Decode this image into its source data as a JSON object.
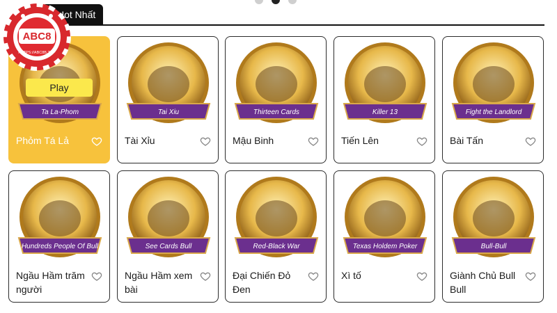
{
  "tab_active_label": "Hot Nhất",
  "logo": {
    "text": "ABC8",
    "url": "HTTPS://ABC8B.TOP"
  },
  "play_label": "Play",
  "cards": [
    {
      "title": "Phỏm Tá Lả",
      "banner": "Ta La-Phom",
      "highlight": true
    },
    {
      "title": "Tài Xỉu",
      "banner": "Tai Xiu"
    },
    {
      "title": "Mậu Binh",
      "banner": "Thirteen Cards"
    },
    {
      "title": "Tiến Lên",
      "banner": "Killer 13"
    },
    {
      "title": "Bài Tấn",
      "banner": "Fight the Landlord"
    },
    {
      "title": "Ngầu Hầm trăm người",
      "banner": "Hundreds People Of Bull"
    },
    {
      "title": "Ngầu Hầm xem bài",
      "banner": "See Cards Bull"
    },
    {
      "title": "Đại Chiến Đỏ Đen",
      "banner": "Red-Black War"
    },
    {
      "title": "Xì tố",
      "banner": "Texas Holdem Poker"
    },
    {
      "title": "Giành Chủ Bull Bull",
      "banner": "Bull-Bull"
    }
  ],
  "colors": {
    "highlight": "#f7c23c",
    "banner": "#6b2f8e",
    "ring": "#c9962e",
    "play": "#fbe84c"
  }
}
